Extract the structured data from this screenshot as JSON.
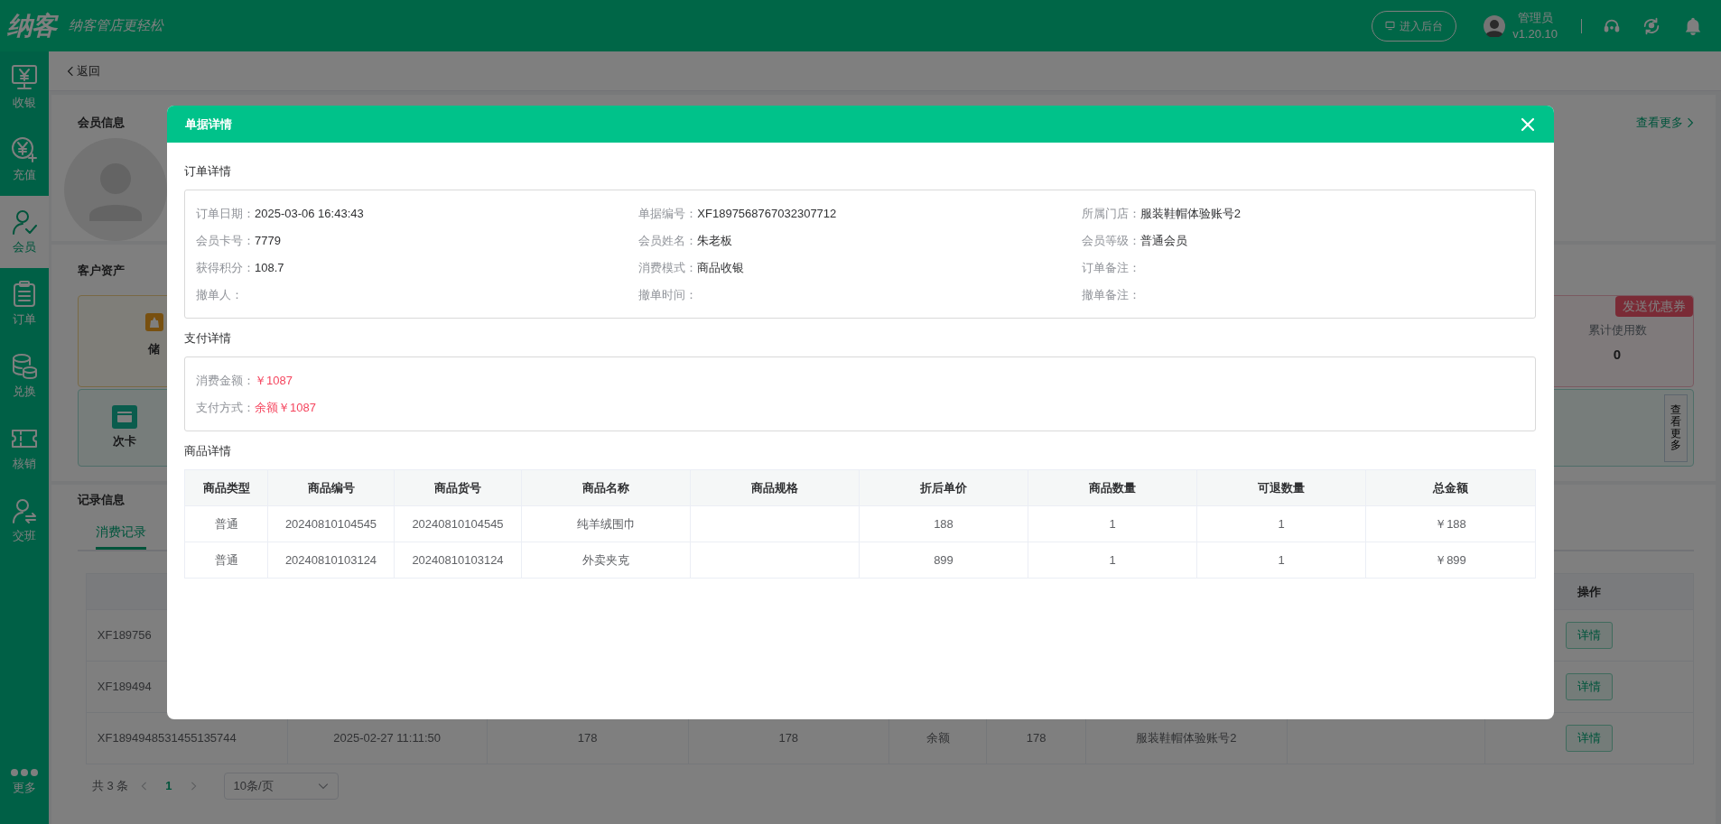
{
  "header": {
    "logo": "纳客",
    "slogan": "纳客管店更轻松",
    "backend_button": "进入后台",
    "user_name": "管理员",
    "version": "v1.20.10"
  },
  "sidebar": {
    "items": [
      {
        "label": "收银",
        "kind": "monitor",
        "selected": false
      },
      {
        "label": "充值",
        "kind": "recharge",
        "selected": false
      },
      {
        "label": "会员",
        "kind": "member",
        "selected": true
      },
      {
        "label": "订单",
        "kind": "order",
        "selected": false
      },
      {
        "label": "兑换",
        "kind": "exchange",
        "selected": false
      },
      {
        "label": "核销",
        "kind": "ticket",
        "selected": false
      },
      {
        "label": "交班",
        "kind": "handover",
        "selected": false
      }
    ],
    "more": "更多"
  },
  "back_link": "返回",
  "member_info": {
    "title": "会员信息",
    "more_link": "查看更多"
  },
  "assets": {
    "title": "客户资产",
    "stored_card_label": "储",
    "coupon_card": {
      "badge": "发送优惠券",
      "label": "累计使用数",
      "value": "0"
    },
    "times_card": {
      "label": "次卡",
      "more_button": "查看更多"
    }
  },
  "records": {
    "title": "记录信息",
    "tabs": [
      {
        "label": "消费记录",
        "selected": true
      }
    ],
    "action_header": "操作",
    "rows": [
      {
        "cells": [
          "XF189756"
        ],
        "action": "详情"
      },
      {
        "cells": [
          "XF189494"
        ],
        "action": "详情"
      },
      {
        "cells": [
          "XF1894948531455135744",
          "2025-02-27 11:11:50",
          "178",
          "178",
          "余额",
          "178",
          "服装鞋帽体验账号2"
        ],
        "action": "详情"
      }
    ]
  },
  "pagination": {
    "total": "共 3 条",
    "pages": [
      {
        "label": "1",
        "selected": true
      }
    ],
    "page_size": "10条/页"
  },
  "dialog": {
    "title": "单据详情",
    "sections": [
      {
        "title": "订单详情",
        "kind": "grid",
        "fields": [
          {
            "label": "订单日期：",
            "value": "2025-03-06 16:43:43"
          },
          {
            "label": "单据编号：",
            "value": "XF1897568767032307712"
          },
          {
            "label": "所属门店：",
            "value": "服装鞋帽体验账号2"
          },
          {
            "label": "会员卡号：",
            "value": "7779"
          },
          {
            "label": "会员姓名：",
            "value": "朱老板"
          },
          {
            "label": "会员等级：",
            "value": "普通会员"
          },
          {
            "label": "获得积分：",
            "value": "108.7"
          },
          {
            "label": "消费模式：",
            "value": "商品收银"
          },
          {
            "label": "订单备注："
          },
          {
            "label": "撤单人："
          },
          {
            "label": "撤单时间："
          },
          {
            "label": "撤单备注："
          }
        ]
      },
      {
        "title": "支付详情",
        "kind": "list",
        "fields": [
          {
            "label": "消费金额：",
            "value": "￥1087",
            "highlight": true
          },
          {
            "label": "支付方式：",
            "value": "余额￥1087",
            "highlight": true
          }
        ]
      },
      {
        "title": "商品详情",
        "kind": "table",
        "columns": [
          "商品类型",
          "商品编号",
          "商品货号",
          "商品名称",
          "商品规格",
          "折后单价",
          "商品数量",
          "可退数量",
          "总金额"
        ],
        "rows": [
          [
            "普通",
            "20240810104545",
            "20240810104545",
            "纯羊绒围巾",
            null,
            "188",
            "1",
            "1",
            "￥188"
          ],
          [
            "普通",
            "20240810103124",
            "20240810103124",
            "外卖夹克",
            null,
            "899",
            "1",
            "1",
            "￥899"
          ]
        ]
      }
    ]
  }
}
